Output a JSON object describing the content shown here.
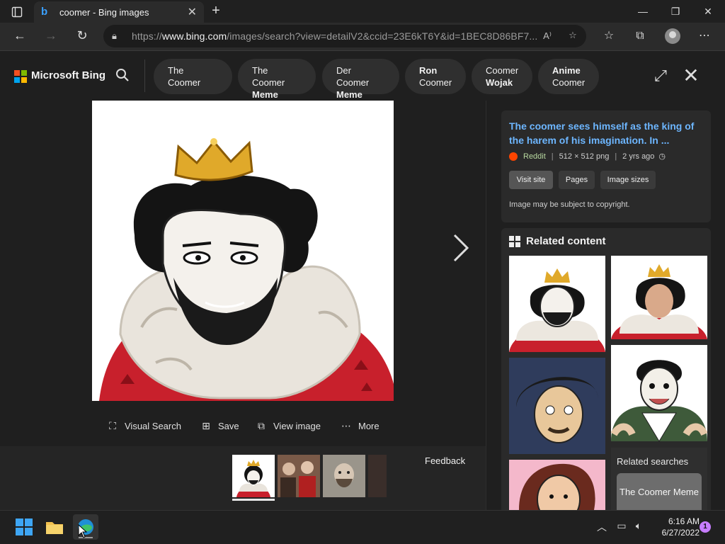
{
  "browser": {
    "tab_title": "coomer - Bing images",
    "url_prefix": "https://",
    "url_domain": "www.bing.com",
    "url_path": "/images/search?view=detailV2&ccid=23E6kT6Y&id=1BEC8D86BF7...",
    "icons": [
      "tab-actions-icon",
      "bing-favicon",
      "close-tab-icon",
      "new-tab-icon",
      "minimize-icon",
      "restore-icon",
      "close-window-icon",
      "back-icon",
      "forward-icon",
      "refresh-icon",
      "lock-icon",
      "read-aloud-icon",
      "add-favorite-icon",
      "favorites-icon",
      "collections-icon",
      "profile-icon",
      "more-icon"
    ]
  },
  "header": {
    "brand": "Microsoft Bing",
    "logo_colors": [
      "#f25022",
      "#7fba00",
      "#00a4ef",
      "#ffb900"
    ],
    "chips": [
      {
        "line1": "The Coomer",
        "line2": ""
      },
      {
        "line1": "The Coomer",
        "line2": "Meme"
      },
      {
        "line1": "Der Coomer",
        "line2": "Meme"
      },
      {
        "line1": "Ron",
        "line2": "Coomer"
      },
      {
        "line1": "Coomer",
        "line2": "Wojak"
      },
      {
        "line1": "Anime",
        "line2": "Coomer"
      }
    ]
  },
  "viewer": {
    "actions": [
      {
        "label": "Visual Search",
        "icon": "visual-search-icon"
      },
      {
        "label": "Save",
        "icon": "save-icon"
      },
      {
        "label": "View image",
        "icon": "view-image-icon"
      },
      {
        "label": "More",
        "icon": "more-dots-icon"
      }
    ],
    "feedback": "Feedback"
  },
  "info": {
    "title": "The coomer sees himself as the king of the harem of his imagination. In ...",
    "source": "Reddit",
    "dimensions": "512 × 512 png",
    "age": "2 yrs ago",
    "buttons": [
      "Visit site",
      "Pages",
      "Image sizes"
    ],
    "copyright": "Image may be subject to copyright."
  },
  "related": {
    "heading": "Related content",
    "searches_label": "Related searches",
    "search_tile": "The Coomer Meme"
  },
  "taskbar": {
    "time": "6:16 AM",
    "date": "6/27/2022",
    "notification_count": "1"
  },
  "colors": {
    "link": "#6db6ff",
    "accent": "#3aa0ff"
  }
}
